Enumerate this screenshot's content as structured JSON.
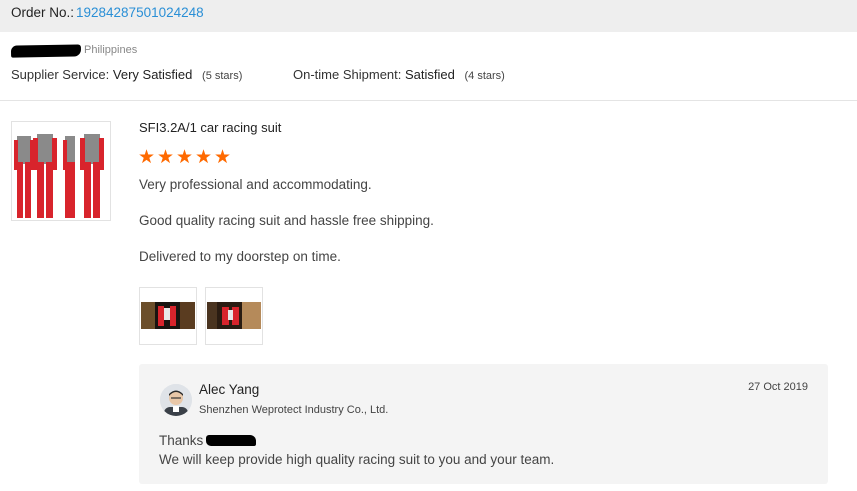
{
  "order": {
    "label": "Order No.:",
    "number": "19284287501024248"
  },
  "buyer": {
    "country": "Philippines"
  },
  "ratings": {
    "supplier_label": "Supplier Service:",
    "supplier_value": "Very Satisfied",
    "supplier_stars": "(5 stars)",
    "shipment_label": "On-time Shipment:",
    "shipment_value": "Satisfied",
    "shipment_stars": "(4 stars)"
  },
  "product": {
    "title": "SFI3.2A/1 car racing suit",
    "rating": 5,
    "accent": "#ff6a00"
  },
  "review": {
    "lines": [
      "Very professional and accommodating.",
      "Good quality racing suit and hassle free shipping.",
      "Delivered to my doorstep on time."
    ]
  },
  "reply": {
    "name": "Alec Yang",
    "company": "Shenzhen Weprotect Industry Co., Ltd.",
    "date": "27 Oct 2019",
    "greeting": "Thanks",
    "message": "We will keep provide high quality racing suit to you and your team."
  },
  "colors": {
    "link": "#2a8fd6",
    "star": "#ff6a00",
    "suit_red": "#d8242c",
    "suit_gray": "#8a8a8a"
  }
}
